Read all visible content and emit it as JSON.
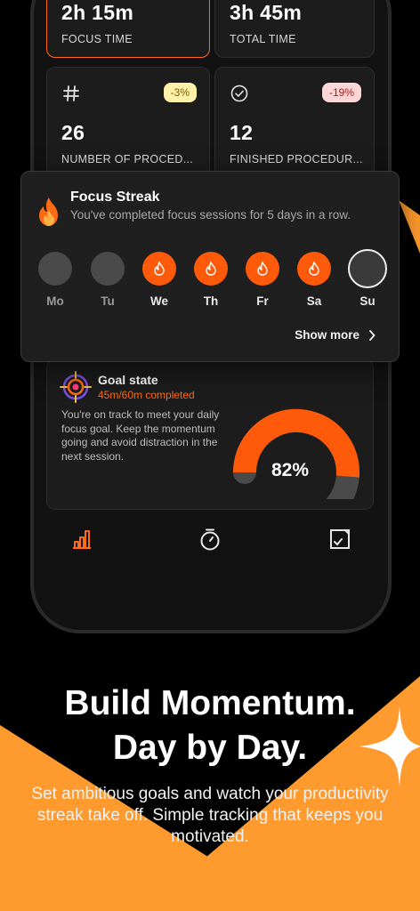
{
  "stats": {
    "focus_time": {
      "value": "2h 15m",
      "label": "FOCUS TIME"
    },
    "total_time": {
      "value": "3h 45m",
      "label": "TOTAL TIME"
    },
    "procedures": {
      "value": "26",
      "label": "NUMBER OF PROCED...",
      "badge": "-3%"
    },
    "finished": {
      "value": "12",
      "label": "FINISHED PROCEDUR...",
      "badge": "-19%"
    }
  },
  "streak": {
    "title": "Focus Streak",
    "description": "You've completed focus sessions for 5 days in a row.",
    "days": [
      {
        "label": "Mo",
        "state": "off"
      },
      {
        "label": "Tu",
        "state": "off"
      },
      {
        "label": "We",
        "state": "on"
      },
      {
        "label": "Th",
        "state": "on"
      },
      {
        "label": "Fr",
        "state": "on"
      },
      {
        "label": "Sa",
        "state": "on"
      },
      {
        "label": "Su",
        "state": "today"
      }
    ],
    "show_more": "Show more"
  },
  "goal": {
    "title": "Goal state",
    "subtitle": "45m/60m completed",
    "description": "You're on track to meet your daily focus goal. Keep the momentum going and avoid distraction in the next session.",
    "percent_label": "82%",
    "percent": 0.82
  },
  "nav": {
    "items": [
      "stats-icon",
      "timer-icon",
      "tasks-icon"
    ]
  },
  "marketing": {
    "headline_line1": "Build Momentum.",
    "headline_line2": "Day by Day.",
    "subline": "Set ambitious goals and watch your productivity streak take off. Simple tracking that keeps you motivated."
  },
  "colors": {
    "accent": "#ff5a0a",
    "background_accent": "#ff9a2e"
  }
}
